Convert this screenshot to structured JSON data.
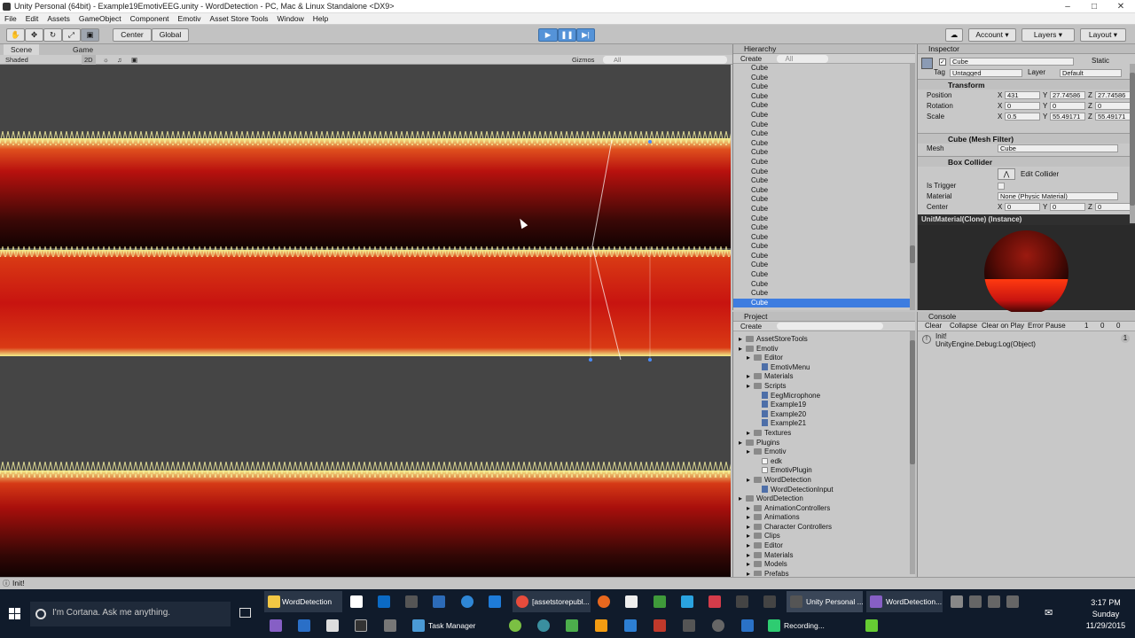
{
  "window": {
    "title": "Unity Personal (64bit) - Example19EmotivEEG.unity - WordDetection - PC, Mac & Linux Standalone <DX9>"
  },
  "menu": [
    "File",
    "Edit",
    "Assets",
    "GameObject",
    "Component",
    "Emotiv",
    "Asset Store Tools",
    "Window",
    "Help"
  ],
  "toolbar": {
    "center_label": "Center",
    "global_label": "Global",
    "account_label": "Account",
    "layers_label": "Layers",
    "layout_label": "Layout"
  },
  "scene": {
    "tab_scene": "Scene",
    "tab_game": "Game",
    "shading": "Shaded",
    "mode_2d": "2D",
    "gizmos": "Gizmos",
    "search_placeholder": "All"
  },
  "hierarchy": {
    "title": "Hierarchy",
    "create": "Create",
    "search_placeholder": "All",
    "items": [
      "Cube",
      "Cube",
      "Cube",
      "Cube",
      "Cube",
      "Cube",
      "Cube",
      "Cube",
      "Cube",
      "Cube",
      "Cube",
      "Cube",
      "Cube",
      "Cube",
      "Cube",
      "Cube",
      "Cube",
      "Cube",
      "Cube",
      "Cube",
      "Cube",
      "Cube",
      "Cube",
      "Cube",
      "Cube",
      "Cube"
    ]
  },
  "inspector": {
    "title": "Inspector",
    "object_name": "Cube",
    "static_label": "Static",
    "tag_label": "Tag",
    "tag_value": "Untagged",
    "layer_label": "Layer",
    "layer_value": "Default",
    "transform": {
      "title": "Transform",
      "position": {
        "label": "Position",
        "x": "431",
        "y": "27.74586",
        "z": "27.74586"
      },
      "rotation": {
        "label": "Rotation",
        "x": "0",
        "y": "0",
        "z": "0"
      },
      "scale": {
        "label": "Scale",
        "x": "0.5",
        "y": "55.49171",
        "z": "55.49171"
      }
    },
    "mesh_filter": {
      "title": "Cube (Mesh Filter)",
      "mesh_label": "Mesh",
      "mesh_value": "Cube"
    },
    "box_collider": {
      "title": "Box Collider",
      "edit_label": "Edit Collider",
      "trigger_label": "Is Trigger",
      "material_label": "Material",
      "material_value": "None (Physic Material)",
      "center_label": "Center",
      "cx": "0",
      "cy": "0",
      "cz": "0"
    },
    "material_title": "UnitMaterial(Clone) (Instance)"
  },
  "project": {
    "title": "Project",
    "create": "Create",
    "tree": [
      {
        "label": "AssetStoreTools",
        "kind": "folder",
        "depth": 0
      },
      {
        "label": "Emotiv",
        "kind": "folder",
        "depth": 0
      },
      {
        "label": "Editor",
        "kind": "folder",
        "depth": 1
      },
      {
        "label": "EmotivMenu",
        "kind": "script",
        "depth": 2
      },
      {
        "label": "Materials",
        "kind": "folder",
        "depth": 1
      },
      {
        "label": "Scripts",
        "kind": "folder",
        "depth": 1
      },
      {
        "label": "EegMicrophone",
        "kind": "script",
        "depth": 2
      },
      {
        "label": "Example19",
        "kind": "script",
        "depth": 2
      },
      {
        "label": "Example20",
        "kind": "script",
        "depth": 2
      },
      {
        "label": "Example21",
        "kind": "script",
        "depth": 2
      },
      {
        "label": "Textures",
        "kind": "folder",
        "depth": 1
      },
      {
        "label": "Plugins",
        "kind": "folder",
        "depth": 0
      },
      {
        "label": "Emotiv",
        "kind": "folder",
        "depth": 1
      },
      {
        "label": "edk",
        "kind": "file",
        "depth": 2
      },
      {
        "label": "EmotivPlugin",
        "kind": "file",
        "depth": 2
      },
      {
        "label": "WordDetection",
        "kind": "folder",
        "depth": 1
      },
      {
        "label": "WordDetectionInput",
        "kind": "script",
        "depth": 2
      },
      {
        "label": "WordDetection",
        "kind": "folder",
        "depth": 0
      },
      {
        "label": "AnimationControllers",
        "kind": "folder",
        "depth": 1
      },
      {
        "label": "Animations",
        "kind": "folder",
        "depth": 1
      },
      {
        "label": "Character Controllers",
        "kind": "folder",
        "depth": 1
      },
      {
        "label": "Clips",
        "kind": "folder",
        "depth": 1
      },
      {
        "label": "Editor",
        "kind": "folder",
        "depth": 1
      },
      {
        "label": "Materials",
        "kind": "folder",
        "depth": 1
      },
      {
        "label": "Models",
        "kind": "folder",
        "depth": 1
      },
      {
        "label": "Prefabs",
        "kind": "folder",
        "depth": 1
      }
    ]
  },
  "console": {
    "title": "Console",
    "clear": "Clear",
    "collapse": "Collapse",
    "clear_on_play": "Clear on Play",
    "error_pause": "Error Pause",
    "count_log": "1",
    "count_warn": "0",
    "count_err": "0",
    "msg1": "Init!",
    "msg2": "UnityEngine.Debug:Log(Object)",
    "msg_count": "1"
  },
  "status": {
    "text": "Init!"
  },
  "taskbar": {
    "cortana": "I'm Cortana. Ask me anything.",
    "apps_top": [
      "WordDetection",
      "[assetstorepubl...",
      "Unity Personal ...",
      "WordDetection..."
    ],
    "apps_bottom": [
      "Task Manager",
      "Recording..."
    ],
    "time": "3:17 PM",
    "day": "Sunday",
    "date": "11/29/2015"
  },
  "colors": {
    "accent": "#3e7de0",
    "scene_bg": "#454545",
    "wave_red": "#c81410",
    "wave_yellow": "#f2ee8a"
  }
}
